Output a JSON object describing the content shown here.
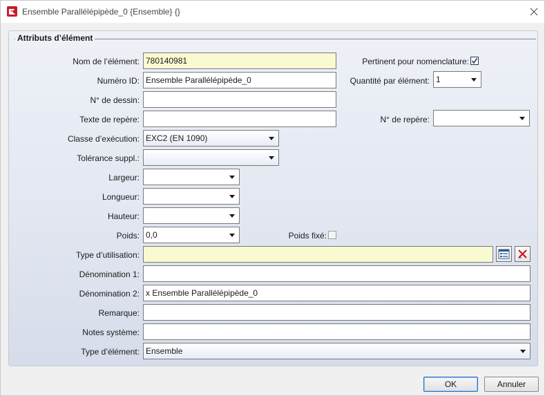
{
  "window": {
    "title": "Ensemble Parallélépipède_0 {Ensemble} {}",
    "app_icon": "app-logo-icon",
    "close_icon": "close-icon"
  },
  "group": {
    "title": "Attributs d’élément"
  },
  "fields": {
    "nom_element": {
      "label": "Nom de l’élément:",
      "value": "780140981"
    },
    "numero_id": {
      "label": "Numéro ID:",
      "value": "Ensemble Parallélépipède_0"
    },
    "no_dessin": {
      "label": "N° de dessin:",
      "value": ""
    },
    "texte_repere": {
      "label": "Texte de repère:",
      "value": ""
    },
    "classe_execution": {
      "label": "Classe d’exécution:",
      "value": "EXC2 (EN 1090)"
    },
    "tolerance_suppl": {
      "label": "Tolérance suppl.:",
      "value": ""
    },
    "largeur": {
      "label": "Largeur:",
      "value": ""
    },
    "longueur": {
      "label": "Longueur:",
      "value": ""
    },
    "hauteur": {
      "label": "Hauteur:",
      "value": ""
    },
    "poids": {
      "label": "Poids:",
      "value": "0,0"
    },
    "type_utilisation": {
      "label": "Type d’utilisation:",
      "value": ""
    },
    "denomination1": {
      "label": "Dénomination 1:",
      "value": ""
    },
    "denomination2": {
      "label": "Dénomination 2:",
      "value": "x Ensemble Parallélépipède_0"
    },
    "remarque": {
      "label": "Remarque:",
      "value": ""
    },
    "notes_systeme": {
      "label": "Notes système:",
      "value": ""
    },
    "type_element": {
      "label": "Type d’élément:",
      "value": "Ensemble"
    }
  },
  "right": {
    "pertinent": {
      "label": "Pertinent pour nomenclature:",
      "checked": true
    },
    "quantite": {
      "label": "Quantité par élément:",
      "value": "1"
    },
    "no_repere": {
      "label": "N° de repère:",
      "value": ""
    }
  },
  "poids_fixe": {
    "label": "Poids fixé:",
    "checked": false
  },
  "buttons": {
    "ok": "OK",
    "cancel": "Annuler",
    "browse_icon": "catalog-icon",
    "delete_icon": "delete-icon"
  },
  "colors": {
    "highlight_field": "#fafad2",
    "delete_red": "#d01818",
    "panel_top": "#eef1f7",
    "panel_bottom": "#d6dcea"
  }
}
